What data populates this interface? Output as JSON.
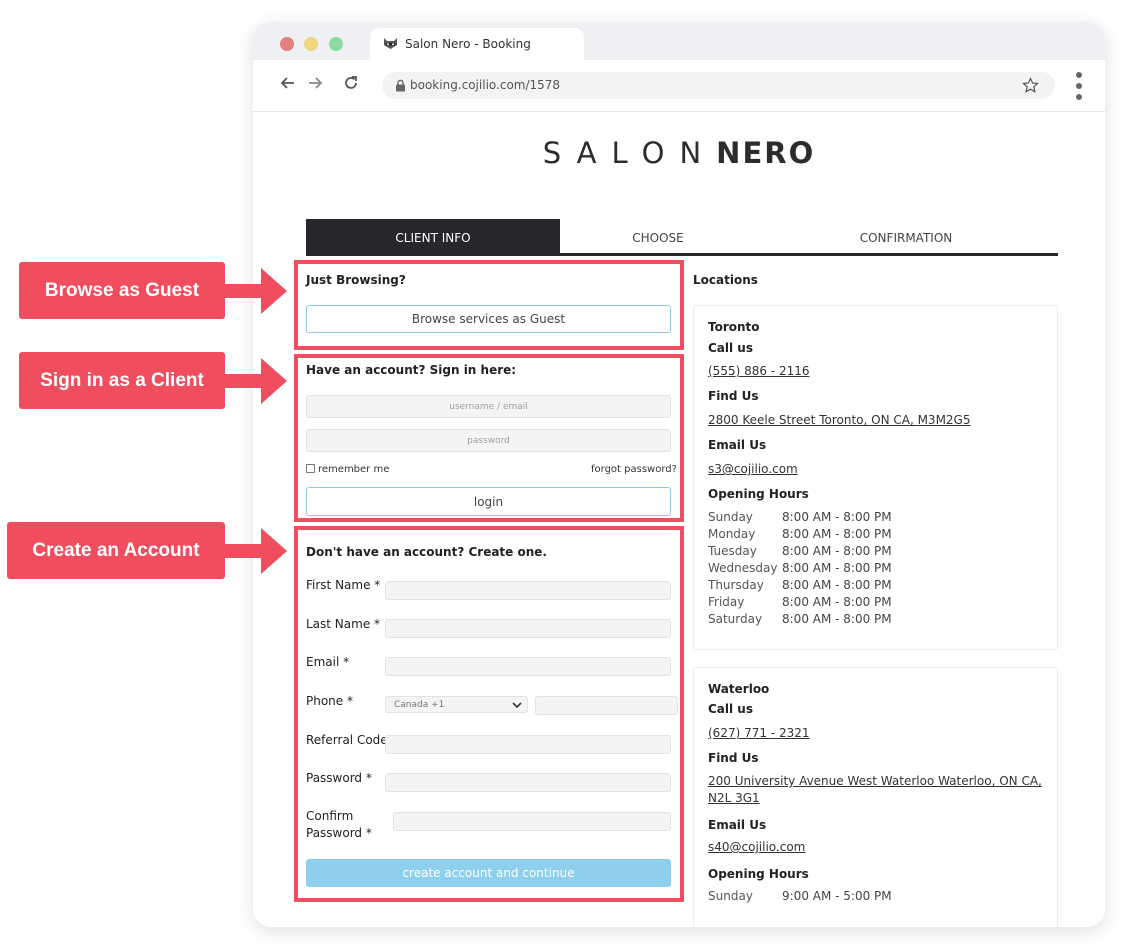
{
  "browser": {
    "tab_title": "Salon Nero - Booking",
    "url": "booking.cojilio.com/1578",
    "colors": {
      "close": "#e4817e",
      "minimize": "#f2d583",
      "maximize": "#8cd9a4"
    },
    "icons": [
      "back-arrow-icon",
      "forward-arrow-icon",
      "reload-icon",
      "lock-icon",
      "star-icon",
      "kebab-menu-icon"
    ]
  },
  "logo": {
    "light": "SALON",
    "bold": "NERO"
  },
  "steps": [
    {
      "label": "CLIENT INFO",
      "active": true
    },
    {
      "label": "CHOOSE",
      "active": false
    },
    {
      "label": "CONFIRMATION",
      "active": false
    }
  ],
  "guest": {
    "title": "Just Browsing?",
    "button": "Browse services as Guest"
  },
  "signin": {
    "title": "Have an account? Sign in here:",
    "username_placeholder": "username / email",
    "password_placeholder": "password",
    "remember": "remember me",
    "forgot": "forgot password?",
    "login": "login"
  },
  "register": {
    "title": "Don't have an account? Create one.",
    "first_name": "First Name *",
    "last_name": "Last Name *",
    "email": "Email *",
    "phone": "Phone *",
    "country": "Canada +1",
    "referral": "Referral Code",
    "password": "Password *",
    "confirm_1": "Confirm",
    "confirm_2": "Password *",
    "submit": "create account and continue"
  },
  "locations": {
    "title": "Locations",
    "call_label": "Call us",
    "find_label": "Find Us",
    "email_label": "Email Us",
    "hours_label": "Opening Hours",
    "toronto": {
      "name": "Toronto",
      "phone": "(555) 886 - 2116",
      "address": "2800 Keele Street Toronto, ON CA, M3M2G5",
      "email": "s3@cojilio.com",
      "hours": [
        {
          "day": "Sunday",
          "time": "8:00 AM - 8:00 PM"
        },
        {
          "day": "Monday",
          "time": "8:00 AM - 8:00 PM"
        },
        {
          "day": "Tuesday",
          "time": "8:00 AM - 8:00 PM"
        },
        {
          "day": "Wednesday",
          "time": "8:00 AM - 8:00 PM"
        },
        {
          "day": "Thursday",
          "time": "8:00 AM - 8:00 PM"
        },
        {
          "day": "Friday",
          "time": "8:00 AM - 8:00 PM"
        },
        {
          "day": "Saturday",
          "time": "8:00 AM - 8:00 PM"
        }
      ]
    },
    "waterloo": {
      "name": "Waterloo",
      "phone": "(627) 771 - 2321",
      "address_1": "200 University Avenue West Waterloo Waterloo, ON CA,",
      "address_2": "N2L 3G1",
      "email": "s40@cojilio.com",
      "hours": [
        {
          "day": "Sunday",
          "time": "9:00 AM - 5:00 PM"
        }
      ]
    }
  },
  "annotations": {
    "guest": "Browse as Guest",
    "client": "Sign in as a Client",
    "account": "Create an Account",
    "color": "#f04e5e"
  }
}
